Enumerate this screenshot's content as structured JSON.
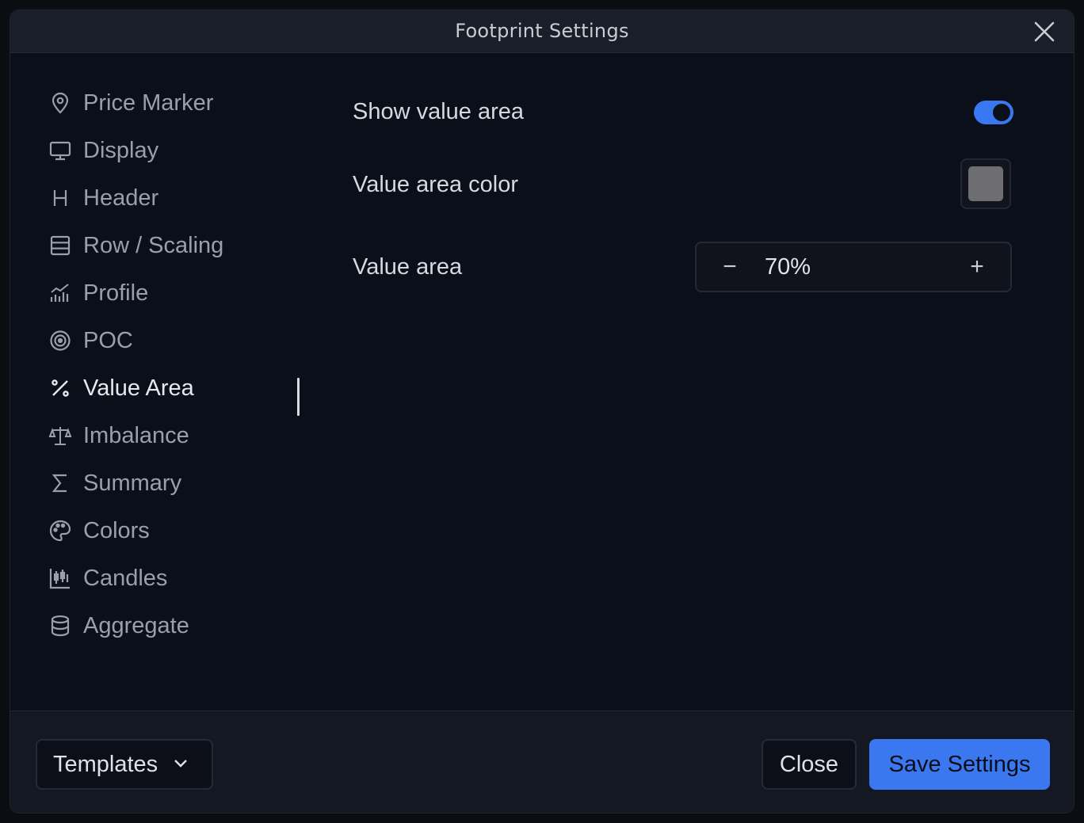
{
  "dialog": {
    "title": "Footprint Settings",
    "close_icon": "close-icon"
  },
  "sidebar": {
    "items": [
      {
        "label": "Price Marker",
        "icon": "map-pin-icon"
      },
      {
        "label": "Display",
        "icon": "monitor-icon"
      },
      {
        "label": "Header",
        "icon": "heading-icon"
      },
      {
        "label": "Row / Scaling",
        "icon": "rows-icon"
      },
      {
        "label": "Profile",
        "icon": "chart-bars-icon"
      },
      {
        "label": "POC",
        "icon": "target-icon"
      },
      {
        "label": "Value Area",
        "icon": "percent-icon",
        "active": true
      },
      {
        "label": "Imbalance",
        "icon": "scale-icon"
      },
      {
        "label": "Summary",
        "icon": "sigma-icon"
      },
      {
        "label": "Colors",
        "icon": "palette-icon"
      },
      {
        "label": "Candles",
        "icon": "candles-icon"
      },
      {
        "label": "Aggregate",
        "icon": "database-icon"
      }
    ]
  },
  "content": {
    "show_value_area": {
      "label": "Show value area",
      "enabled": true
    },
    "value_area_color": {
      "label": "Value area color",
      "color": "#6e6e70"
    },
    "value_area": {
      "label": "Value area",
      "value": "70%",
      "minus": "−",
      "plus": "+"
    }
  },
  "footer": {
    "templates_label": "Templates",
    "close_label": "Close",
    "save_label": "Save Settings"
  },
  "colors": {
    "accent": "#3b78f0",
    "background": "#0b0f19",
    "titlebar": "#1a1e28"
  }
}
